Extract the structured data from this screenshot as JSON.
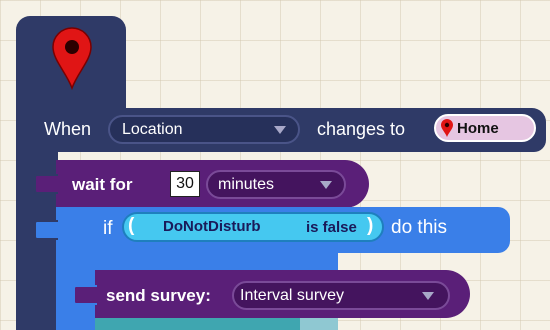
{
  "colors": {
    "event_block": "#2f3a67",
    "control_block": "#5a1f78",
    "if_block": "#3a7fe8",
    "condition_pill": "#45c8f0",
    "location_pill": "#e6c6e2",
    "map_pin": "#e01515"
  },
  "event": {
    "icon": "map-pin-icon",
    "when_label": "When",
    "trigger_value": "Location",
    "changes_label": "changes to",
    "location_icon": "map-pin-icon",
    "location_value": "Home"
  },
  "wait": {
    "label": "wait for",
    "amount": "30",
    "unit": "minutes"
  },
  "if_block": {
    "if_label": "if",
    "open_paren": "(",
    "condition_variable": "DoNotDisturb",
    "condition_state": "is false",
    "close_paren": ")",
    "do_label": "do this"
  },
  "send": {
    "label": "send survey:",
    "survey_value": "Interval survey"
  }
}
